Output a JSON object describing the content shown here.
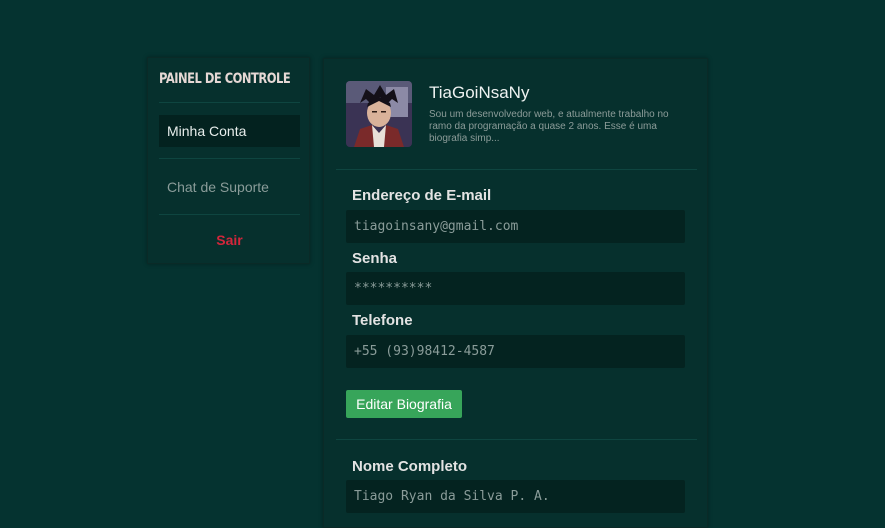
{
  "sidebar": {
    "title": "PAINEL DE CONTROLE",
    "items": [
      {
        "label": "Minha Conta",
        "active": true
      },
      {
        "label": "Chat de Suporte",
        "active": false
      }
    ],
    "logout_label": "Sair"
  },
  "profile": {
    "username": "TiaGoiNsaNy",
    "bio": "Sou um desenvolvedor web, e atualmente trabalho no ramo da programação a quase 2 anos. Esse é uma biografia simp..."
  },
  "fields": {
    "email_label": "Endereço de E-mail",
    "email_value": "tiagoinsany@gmail.com",
    "password_label": "Senha",
    "password_value": "**********",
    "phone_label": "Telefone",
    "phone_value": "+55 (93)98412-4587",
    "fullname_label": "Nome Completo",
    "fullname_value": "Tiago Ryan da Silva P. A."
  },
  "buttons": {
    "edit_bio_label": "Editar Biografia"
  },
  "colors": {
    "background": "#053330",
    "accent_green": "#37a55a",
    "logout_red": "#d1263b"
  }
}
